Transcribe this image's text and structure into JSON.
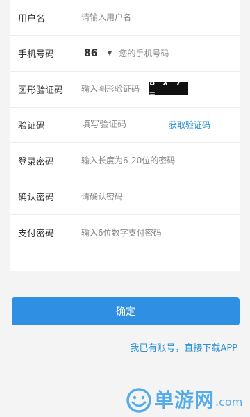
{
  "form": {
    "username": {
      "label": "用户名",
      "placeholder": "请输入用户名"
    },
    "phone": {
      "label": "手机号码",
      "country_code": "86",
      "caret": "▼",
      "placeholder": "您的手机号码"
    },
    "captcha": {
      "label": "图形验证码",
      "placeholder": "输入图形验证码",
      "image_text": "8 x 7 ="
    },
    "sms_code": {
      "label": "验证码",
      "placeholder": "填写验证码",
      "get_code": "获取验证码"
    },
    "password": {
      "label": "登录密码",
      "placeholder": "输入长度为6-20位的密码"
    },
    "confirm_password": {
      "label": "确认密码",
      "placeholder": "请确认密码"
    },
    "pay_password": {
      "label": "支付密码",
      "placeholder": "输入6位数字支付密码"
    }
  },
  "confirm_button": "确定",
  "download_link": "我已有账号，直接下载APP",
  "watermark": {
    "logo": "单游网",
    "domain": ".com"
  },
  "colors": {
    "accent": "#2f8fe3",
    "link": "#2a8fd4",
    "background": "#f4f4f4",
    "card": "#ffffff"
  }
}
